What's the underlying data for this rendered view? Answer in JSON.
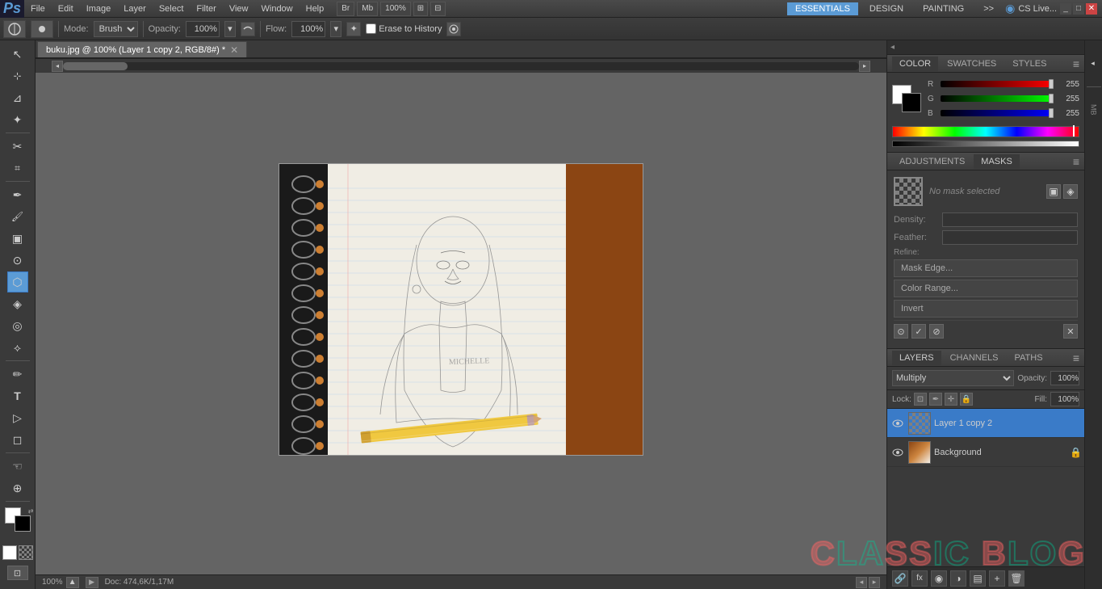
{
  "app": {
    "logo": "Ps",
    "title": "buku.jpg @ 100% (Layer 1 copy 2, RGB/8#) *"
  },
  "menubar": {
    "items": [
      "File",
      "Edit",
      "Image",
      "Layer",
      "Select",
      "Filter",
      "View",
      "Window",
      "Help"
    ],
    "bridge_btn": "Br",
    "mini_bridge_btn": "Mb",
    "zoom_label": "100%",
    "arrange_btn": "⊞",
    "screen_mode_btn": "⊟",
    "essentials_btn": "ESSENTIALS",
    "design_btn": "DESIGN",
    "painting_btn": "PAINTING",
    "more_btn": ">>",
    "cs_live_label": "CS Live...",
    "window_controls": {
      "minimize": "_",
      "maximize": "□",
      "close": "✕"
    }
  },
  "optionsbar": {
    "brush_label": "Brush",
    "mode_label": "Mode:",
    "mode_value": "Brush",
    "opacity_label": "Opacity:",
    "opacity_value": "100%",
    "flow_label": "Flow:",
    "flow_value": "100%",
    "erase_to_history_label": "Erase to History"
  },
  "tab": {
    "title": "buku.jpg @ 100% (Layer 1 copy 2, RGB/8#) *",
    "close": "✕"
  },
  "color_panel": {
    "title": "COLOR",
    "tabs": [
      "COLOR",
      "SWATCHES",
      "STYLES"
    ],
    "r_label": "R",
    "g_label": "G",
    "b_label": "B",
    "r_value": "255",
    "g_value": "255",
    "b_value": "255"
  },
  "masks_panel": {
    "adj_tab": "ADJUSTMENTS",
    "masks_tab": "MASKS",
    "no_mask_label": "No mask selected",
    "density_label": "Density:",
    "feather_label": "Feather:",
    "refine_label": "Refine:",
    "mask_edge_btn": "Mask Edge...",
    "color_range_btn": "Color Range...",
    "invert_btn": "Invert"
  },
  "layers_panel": {
    "title": "LAYERS",
    "channels_tab": "CHANNELS",
    "paths_tab": "PATHS",
    "blend_mode": "Multiply",
    "opacity_label": "Opacity:",
    "opacity_value": "100%",
    "fill_label": "Fill:",
    "fill_value": "100%",
    "lock_label": "Lock:",
    "layers": [
      {
        "name": "Layer 1 copy 2",
        "active": true,
        "visible": true,
        "type": "normal"
      },
      {
        "name": "Background",
        "active": false,
        "visible": true,
        "type": "bg",
        "locked": true
      }
    ],
    "bottom_icons": [
      "+",
      "fx",
      "◉",
      "▤",
      "✕"
    ]
  },
  "statusbar": {
    "zoom": "100%",
    "doc_info": "Doc: 474,6K/1,17M"
  },
  "tools": [
    {
      "icon": "↖",
      "name": "move-tool"
    },
    {
      "icon": "⊹",
      "name": "marquee-tool"
    },
    {
      "icon": "⊿",
      "name": "lasso-tool"
    },
    {
      "icon": "✦",
      "name": "magic-wand-tool"
    },
    {
      "icon": "✂",
      "name": "crop-tool"
    },
    {
      "icon": "⌗",
      "name": "eyedropper-tool"
    },
    {
      "icon": "✒",
      "name": "healing-tool"
    },
    {
      "icon": "🖌",
      "name": "brush-tool"
    },
    {
      "icon": "▣",
      "name": "clone-tool"
    },
    {
      "icon": "⊙",
      "name": "history-tool"
    },
    {
      "icon": "⬡",
      "name": "eraser-tool"
    },
    {
      "icon": "◈",
      "name": "gradient-tool"
    },
    {
      "icon": "◎",
      "name": "blur-tool"
    },
    {
      "icon": "⟡",
      "name": "dodge-tool"
    },
    {
      "icon": "✏",
      "name": "pen-tool"
    },
    {
      "icon": "T",
      "name": "type-tool"
    },
    {
      "icon": "▷",
      "name": "path-tool"
    },
    {
      "icon": "◻",
      "name": "shape-tool"
    },
    {
      "icon": "☜",
      "name": "hand-tool"
    },
    {
      "icon": "⊕",
      "name": "zoom-tool"
    }
  ]
}
